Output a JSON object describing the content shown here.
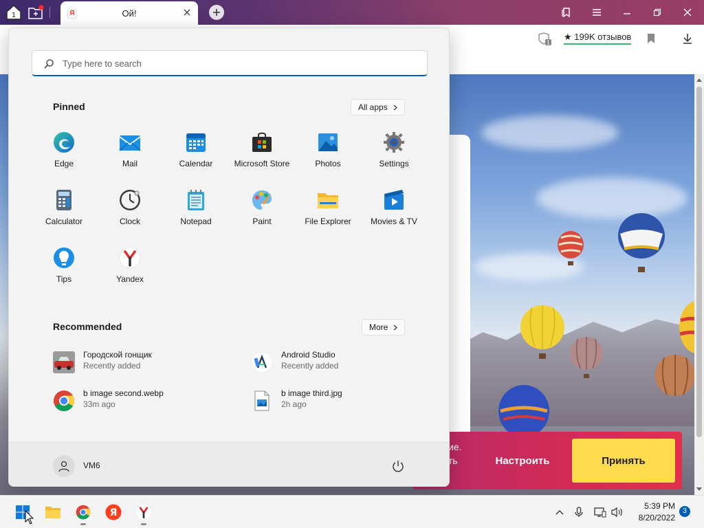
{
  "browser": {
    "tab": {
      "title": "Ой!",
      "favicon": "Я"
    },
    "reviews": "★ 199K отзывов",
    "home_badge": "1",
    "shield_badge": "1"
  },
  "webpage": {
    "consent": {
      "line1": "ие.",
      "line2": "ть",
      "setup_label": "Настроить",
      "accept_label": "Принять"
    }
  },
  "start_menu": {
    "search_placeholder": "Type here to search",
    "pinned_title": "Pinned",
    "all_apps_label": "All apps",
    "pinned": [
      {
        "label": "Edge",
        "icon": "edge-icon"
      },
      {
        "label": "Mail",
        "icon": "mail-icon"
      },
      {
        "label": "Calendar",
        "icon": "calendar-icon"
      },
      {
        "label": "Microsoft Store",
        "icon": "store-icon"
      },
      {
        "label": "Photos",
        "icon": "photos-icon"
      },
      {
        "label": "Settings",
        "icon": "settings-icon"
      },
      {
        "label": "Calculator",
        "icon": "calculator-icon"
      },
      {
        "label": "Clock",
        "icon": "clock-icon"
      },
      {
        "label": "Notepad",
        "icon": "notepad-icon"
      },
      {
        "label": "Paint",
        "icon": "paint-icon"
      },
      {
        "label": "File Explorer",
        "icon": "folder-icon"
      },
      {
        "label": "Movies & TV",
        "icon": "movies-icon"
      },
      {
        "label": "Tips",
        "icon": "tips-icon"
      },
      {
        "label": "Yandex",
        "icon": "yandex-icon"
      }
    ],
    "recommended_title": "Recommended",
    "more_label": "More",
    "recommended": [
      {
        "title": "Городской гонщик",
        "subtitle": "Recently added",
        "icon": "game-car-icon"
      },
      {
        "title": "Android Studio",
        "subtitle": "Recently added",
        "icon": "android-studio-icon"
      },
      {
        "title": "b image second.webp",
        "subtitle": "33m ago",
        "icon": "chrome-icon"
      },
      {
        "title": "b image third.jpg",
        "subtitle": "2h ago",
        "icon": "image-file-icon"
      }
    ],
    "user_name": "VM6"
  },
  "taskbar": {
    "time": "5:39 PM",
    "date": "8/20/2022",
    "notification_count": "3"
  },
  "colors": {
    "accent": "#005fb8",
    "consent_start": "#b72a68",
    "consent_end": "#e0304a",
    "accept_button": "#ffdb4d"
  }
}
